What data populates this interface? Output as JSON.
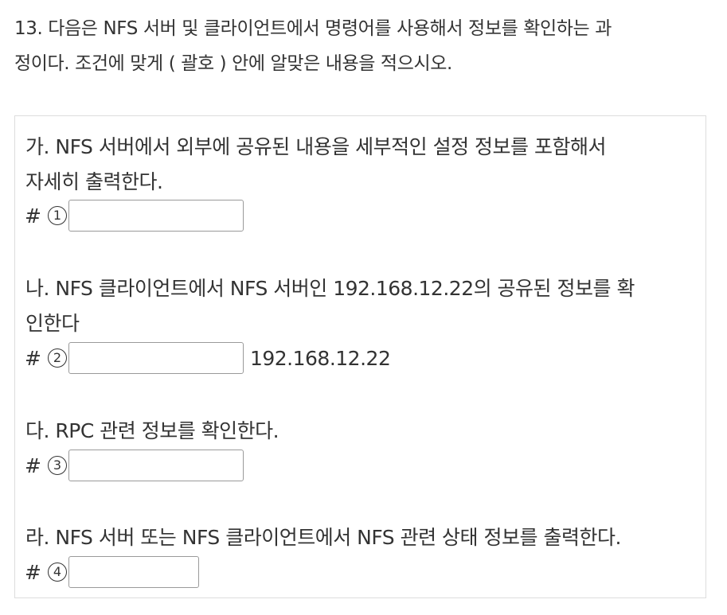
{
  "question": {
    "line1": "13. 다음은 NFS 서버 및 클라이언트에서 명령어를 사용해서 정보를 확인하는 과",
    "line2": "정이다. 조건에 맞게 ( 괄호 ) 안에 알맞은 내용을 적으시오."
  },
  "items": [
    {
      "line1": "가. NFS 서버에서 외부에 공유된 내용을 세부적인 설정 정보를 포함해서",
      "line2": "자세히 출력한다.",
      "prompt": "#",
      "marker": "1",
      "value": "",
      "suffix": ""
    },
    {
      "line1": "나. NFS 클라이언트에서 NFS 서버인 192.168.12.22의 공유된 정보를 확",
      "line2": "인한다",
      "prompt": "#",
      "marker": "2",
      "value": "",
      "suffix": "192.168.12.22"
    },
    {
      "line1": "다. RPC 관련 정보를 확인한다.",
      "prompt": "#",
      "marker": "3",
      "value": ""
    },
    {
      "line1": "라. NFS 서버 또는 NFS 클라이언트에서 NFS 관련 상태 정보를 출력한다.",
      "prompt": "#",
      "marker": "4",
      "value": ""
    }
  ]
}
